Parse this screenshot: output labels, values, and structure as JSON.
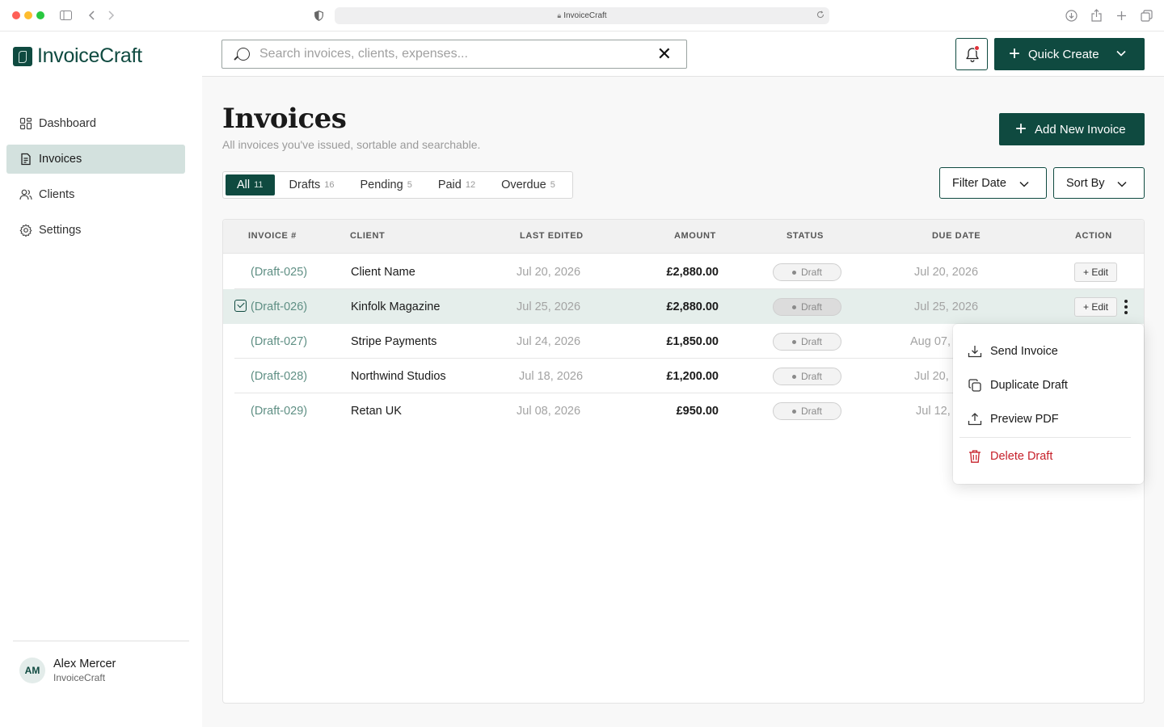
{
  "browser": {
    "url": "InvoiceCraft"
  },
  "sidebar": {
    "logo": "InvoiceCraft",
    "items": [
      {
        "label": "Dashboard",
        "icon": "dashboard-icon",
        "active": false
      },
      {
        "label": "Invoices",
        "icon": "document-icon",
        "active": true
      },
      {
        "label": "Clients",
        "icon": "users-icon",
        "active": false
      },
      {
        "label": "Settings",
        "icon": "gear-icon",
        "active": false
      }
    ],
    "user": {
      "initials": "AM",
      "name": "Alex Mercer",
      "org": "InvoiceCraft"
    }
  },
  "topbar": {
    "search_placeholder": "Search invoices, clients, expenses...",
    "search_value": "",
    "quick_create_label": "Quick Create"
  },
  "page": {
    "title": "Invoices",
    "subtitle": "All invoices you've issued, sortable and searchable.",
    "add_button": "Add New Invoice",
    "filter_date": "Filter Date",
    "sort_by": "Sort By"
  },
  "tabs": [
    {
      "label": "All",
      "count": "11",
      "active": true
    },
    {
      "label": "Drafts",
      "count": "16",
      "active": false
    },
    {
      "label": "Pending",
      "count": "5",
      "active": false
    },
    {
      "label": "Paid",
      "count": "12",
      "active": false
    },
    {
      "label": "Overdue",
      "count": "5",
      "active": false
    }
  ],
  "table": {
    "columns": [
      "INVOICE #",
      "CLIENT",
      "LAST EDITED",
      "AMOUNT",
      "STATUS",
      "DUE DATE",
      "ACTION"
    ],
    "rows": [
      {
        "id": "(Draft-025)",
        "client": "Client Name",
        "last_edited": "Jul 20, 2026",
        "amount": "£2,880.00",
        "status": "Draft",
        "due": "Jul 20, 2026"
      },
      {
        "id": "(Draft-026)",
        "client": "Kinfolk Magazine",
        "last_edited": "Jul 25, 2026",
        "amount": "£2,880.00",
        "status": "Draft",
        "due": "Jul 25, 2026"
      },
      {
        "id": "(Draft-027)",
        "client": "Stripe Payments",
        "last_edited": "Jul 24, 2026",
        "amount": "£1,850.00",
        "status": "Draft",
        "due": "Aug 07,"
      },
      {
        "id": "(Draft-028)",
        "client": "Northwind Studios",
        "last_edited": "Jul 18, 2026",
        "amount": "£1,200.00",
        "status": "Draft",
        "due": "Jul 20,"
      },
      {
        "id": "(Draft-029)",
        "client": "Retan UK",
        "last_edited": "Jul 08, 2026",
        "amount": "£950.00",
        "status": "Draft",
        "due": "Jul 12,"
      }
    ],
    "edit_label": "+ Edit"
  },
  "menu": {
    "items": [
      {
        "label": "Send Invoice",
        "icon": "download-icon"
      },
      {
        "label": "Duplicate Draft",
        "icon": "duplicate-icon"
      },
      {
        "label": "Preview PDF",
        "icon": "upload-icon"
      },
      {
        "label": "Delete Draft",
        "icon": "trash-icon",
        "danger": true
      }
    ]
  },
  "colors": {
    "brand": "#0f4a40",
    "active_nav": "#d3e1de",
    "row_highlight": "#e5eeeb",
    "danger": "#c6202a"
  }
}
